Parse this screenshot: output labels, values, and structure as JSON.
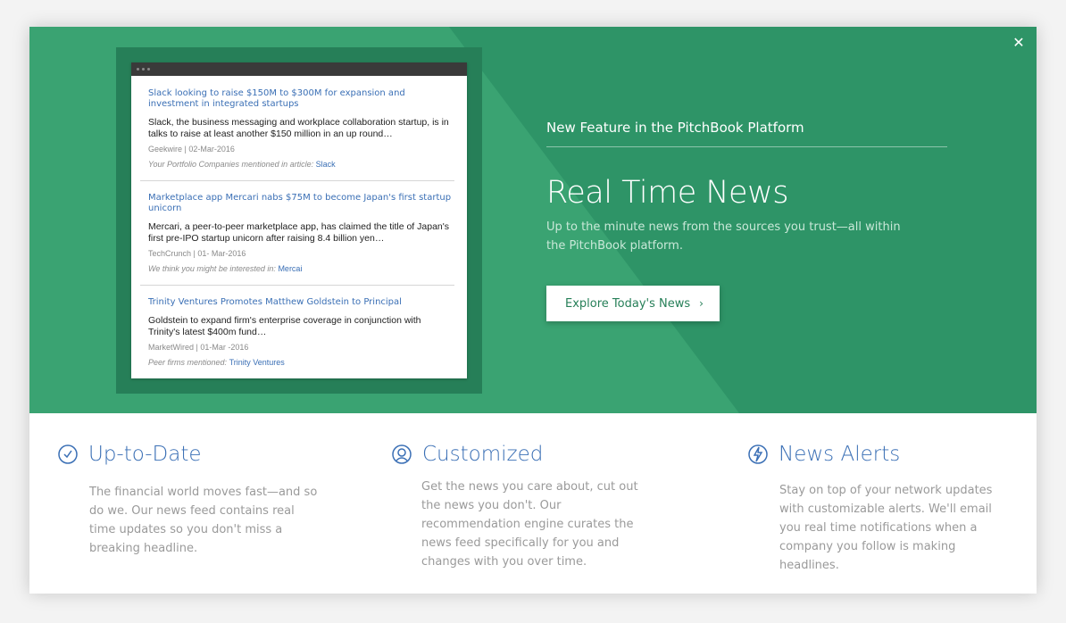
{
  "modal": {
    "close_icon": "close-icon"
  },
  "articles": [
    {
      "title": "Slack looking to raise $150M to $300M for expansion and investment in integrated startups",
      "summary": "Slack, the business messaging and workplace collaboration startup, is in talks to raise at least another $150 million in an up round…",
      "meta": "Geekwire | 02-Mar-2016",
      "mention_label": "Your Portfolio Companies mentioned in article:",
      "mention_link": "Slack"
    },
    {
      "title": "Marketplace app Mercari nabs $75M to become Japan's first startup unicorn",
      "summary": "Mercari, a peer-to-peer marketplace app, has claimed the title of Japan's first pre-IPO startup unicorn after raising 8.4 billion yen…",
      "meta": "TechCrunch | 01- Mar-2016",
      "mention_label": "We think you might be interested in:",
      "mention_link": "Mercai"
    },
    {
      "title": "Trinity Ventures Promotes Matthew Goldstein to Principal",
      "summary": "Goldstein to expand firm's enterprise coverage in conjunction with Trinity's latest $400m fund…",
      "meta": "MarketWired | 01-Mar -2016",
      "mention_label": "Peer firms mentioned:",
      "mention_link": "Trinity Ventures"
    }
  ],
  "promo": {
    "eyebrow": "New Feature in the PitchBook Platform",
    "title": "Real Time News",
    "subtitle": "Up to the minute news from the sources you trust—all within the PitchBook platform.",
    "cta_label": "Explore Today's News",
    "cta_chevron": "›"
  },
  "features": [
    {
      "icon": "clock-icon",
      "title": "Up-to-Date",
      "description": "The financial world moves fast—and so do we. Our news feed contains real time updates so you don't miss a breaking headline."
    },
    {
      "icon": "user-icon",
      "title": "Customized",
      "description": "Get the news you care about, cut out the news you don't. Our recommendation engine curates the news feed specifically for you and changes with you over time."
    },
    {
      "icon": "lightning-icon",
      "title": "News Alerts",
      "description": "Stay on top of your network updates with customizable alerts. We'll email you real time notifications when a company you follow is making headlines."
    }
  ],
  "colors": {
    "brand_green": "#2e9467",
    "link_blue": "#3a6fb5"
  }
}
